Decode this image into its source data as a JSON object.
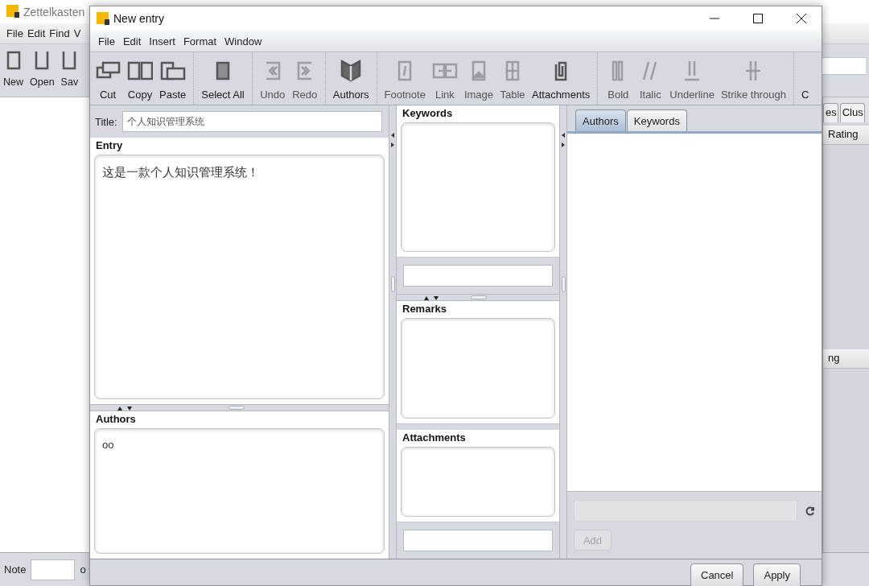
{
  "app": {
    "title": "Zettelkasten",
    "menu": [
      "File",
      "Edit",
      "Find",
      "V"
    ],
    "toolbar": [
      "New",
      "Open",
      "Sav"
    ],
    "tabs": [
      "es",
      "Clus"
    ],
    "column": "Rating",
    "section": "ng",
    "note_label": "Note",
    "note_suffix": "o"
  },
  "dialog": {
    "title": "New entry",
    "menu": [
      "File",
      "Edit",
      "Insert",
      "Format",
      "Window"
    ],
    "toolbar_groups": [
      {
        "items": [
          {
            "label": "Cut",
            "kind": "cut",
            "disabled": false
          },
          {
            "label": "Copy",
            "kind": "copy",
            "disabled": false
          },
          {
            "label": "Paste",
            "kind": "paste",
            "disabled": false
          }
        ]
      },
      {
        "items": [
          {
            "label": "Select All",
            "kind": "select",
            "disabled": false
          }
        ]
      },
      {
        "items": [
          {
            "label": "Undo",
            "kind": "undo",
            "disabled": true
          },
          {
            "label": "Redo",
            "kind": "redo",
            "disabled": true
          }
        ]
      },
      {
        "items": [
          {
            "label": "Authors",
            "kind": "authors",
            "disabled": false
          }
        ]
      },
      {
        "items": [
          {
            "label": "Footnote",
            "kind": "footnote",
            "disabled": true
          },
          {
            "label": "Link",
            "kind": "link",
            "disabled": true
          },
          {
            "label": "Image",
            "kind": "image",
            "disabled": true
          },
          {
            "label": "Table",
            "kind": "table",
            "disabled": true
          },
          {
            "label": "Attachments",
            "kind": "attachment",
            "disabled": false
          }
        ]
      },
      {
        "items": [
          {
            "label": "Bold",
            "kind": "bold",
            "disabled": true
          },
          {
            "label": "Italic",
            "kind": "italic",
            "disabled": true
          },
          {
            "label": "Underline",
            "kind": "underline",
            "disabled": true
          },
          {
            "label": "Strike through",
            "kind": "strike",
            "disabled": true
          }
        ]
      },
      {
        "items": [
          {
            "label": "C",
            "kind": "clipped"
          }
        ]
      }
    ],
    "title_label": "Title:",
    "title_value": "个人知识管理系统",
    "entry_label": "Entry",
    "entry_text": "这是一款个人知识管理系统！",
    "authors_label": "Authors",
    "authors_text": "oo",
    "keywords_label": "Keywords",
    "remarks_label": "Remarks",
    "attachments_label": "Attachments",
    "tabs": [
      {
        "label": "Authors",
        "selected": true
      },
      {
        "label": "Keywords",
        "selected": false
      }
    ],
    "add_button": {
      "label": "Add",
      "disabled": true
    },
    "buttons": [
      "Cancel",
      "Apply"
    ]
  }
}
